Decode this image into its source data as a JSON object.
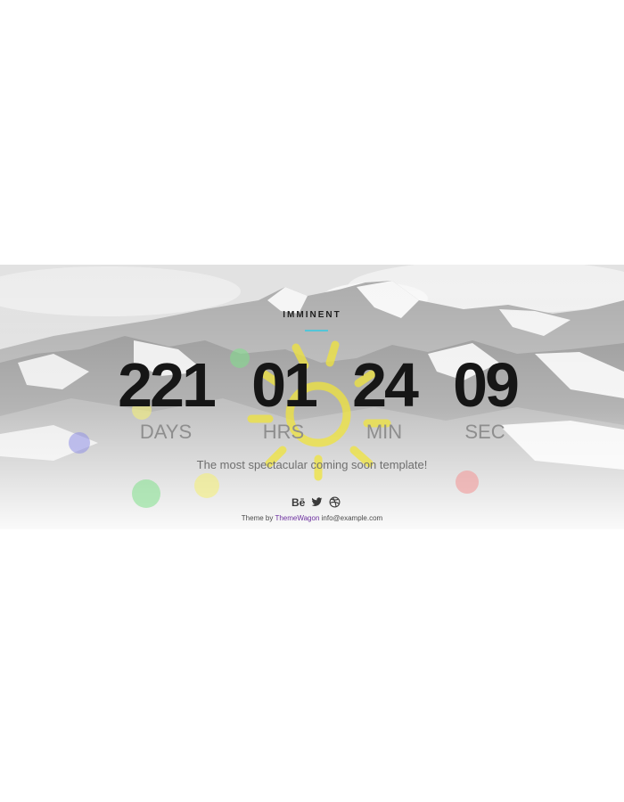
{
  "brand": {
    "title": "IMMINENT",
    "accent": "#53c5d8"
  },
  "countdown": [
    {
      "value": "221",
      "label": "DAYS"
    },
    {
      "value": "01",
      "label": "HRS"
    },
    {
      "value": "24",
      "label": "MIN"
    },
    {
      "value": "09",
      "label": "SEC"
    }
  ],
  "tagline": "The most spectacular coming soon template!",
  "social": [
    {
      "icon": "behance-icon",
      "glyph": "Bē"
    },
    {
      "icon": "twitter-icon"
    },
    {
      "icon": "dribbble-icon"
    }
  ],
  "footer": {
    "prefix": "Theme by",
    "link_text": "ThemeWagon",
    "email": "info@example.com",
    "link_color": "#6b2f9e"
  },
  "colors": {
    "bubble_blue": "#8f8fe6",
    "bubble_green": "#7fe08a",
    "bubble_yellow": "#f4ef7a",
    "bubble_red": "#f29a9a",
    "sun_yellow": "#f0e43c"
  }
}
